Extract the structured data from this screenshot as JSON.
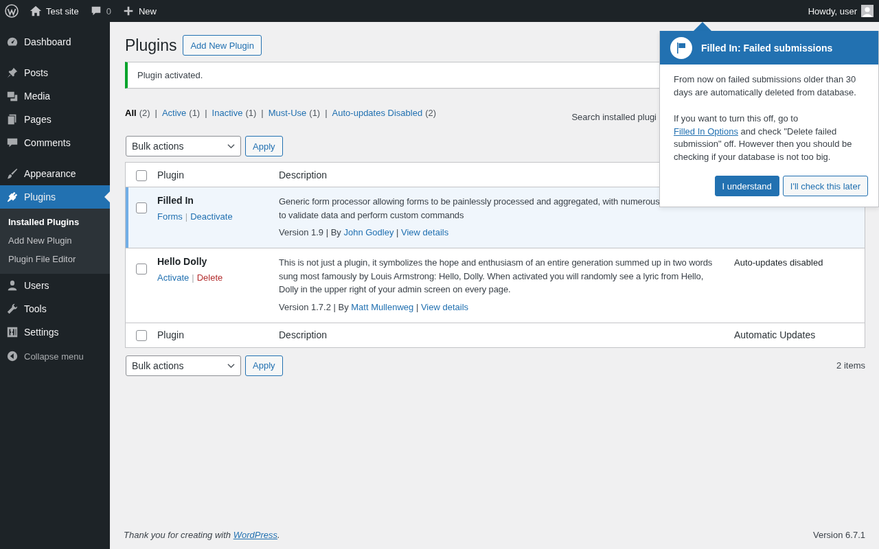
{
  "admin_bar": {
    "site": "Test site",
    "comments": "0",
    "new": "New",
    "greeting": "Howdy, user"
  },
  "menu": [
    {
      "items": [
        {
          "label": "Dashboard",
          "selected": false
        }
      ]
    },
    {
      "items": [
        {
          "label": "Posts",
          "selected": false
        },
        {
          "label": "Media",
          "selected": false
        },
        {
          "label": "Pages",
          "selected": false
        },
        {
          "label": "Comments",
          "selected": false
        }
      ]
    },
    {
      "items": [
        {
          "label": "Appearance",
          "selected": false
        },
        {
          "label": "Plugins",
          "selected": true,
          "submenu": [
            {
              "label": "Installed Plugins",
              "selected": true
            },
            {
              "label": "Add New Plugin",
              "selected": false
            },
            {
              "label": "Plugin File Editor",
              "selected": false
            }
          ]
        },
        {
          "label": "Users",
          "selected": false
        },
        {
          "label": "Tools",
          "selected": false
        },
        {
          "label": "Settings",
          "selected": false
        }
      ]
    }
  ],
  "collapse": "Collapse menu",
  "page": {
    "title": "Plugins",
    "add_button": "Add New Plugin",
    "notice": "Plugin activated.",
    "filters": [
      {
        "label": "All",
        "count": "(2)",
        "selected": true
      },
      {
        "separator": "|",
        "label": "Active",
        "count": "(1)",
        "selected": false
      },
      {
        "separator": "|",
        "label": "Inactive",
        "count": "(1)",
        "selected": false
      },
      {
        "separator": "|",
        "label": "Must-Use",
        "count": "(1)",
        "selected": false
      },
      {
        "separator": "|",
        "label": "Auto-updates Disabled",
        "count": "(2)",
        "selected": false
      }
    ],
    "search_label": "Search installed plugi",
    "bulk_actions": "Bulk actions",
    "apply": "Apply",
    "bulk_actions_bottom": "Bulk actions",
    "apply_bottom": "Apply",
    "items_count": "2 items"
  },
  "table": {
    "header": [
      "Plugin",
      "Description"
    ],
    "footer": [
      "Plugin",
      "Description",
      "Automatic Updates"
    ],
    "select_all_checked": false,
    "rows": [
      {
        "name": "Filled In",
        "active": true,
        "checked": false,
        "actions": [
          {
            "label": "Forms",
            "kind": "link"
          },
          {
            "separator": "|",
            "label": "Deactivate",
            "kind": "link"
          }
        ],
        "description_lines": [
          "Generic form processor allowing forms to be painlessly processed and aggregated, with numerous",
          "to validate data and perform custom commands"
        ],
        "version": "Version 1.9 | By ",
        "author": "John Godley",
        "separator": "|",
        "details": "View details"
      },
      {
        "name": "Hello Dolly",
        "active": false,
        "checked": false,
        "actions": [
          {
            "label": "Activate",
            "kind": "link"
          },
          {
            "separator": "|",
            "label": "Delete",
            "kind": "delete"
          }
        ],
        "description_lines": [
          "This is not just a plugin, it symbolizes the hope and enthusiasm of an entire generation summed up in two words sung most famously by Louis Armstrong: Hello, Dolly. When activated you will randomly see a lyric from Hello, Dolly in the upper right of your admin screen on every page."
        ],
        "version": "Version 1.7.2 | By ",
        "author": "Matt Mullenweg",
        "separator": "|",
        "details": "View details",
        "auto_updates": "Auto-updates disabled"
      }
    ]
  },
  "pointer": {
    "title": "Filled In: Failed submissions",
    "paragraph_1": "From now on failed submissions older than 30 days are automatically deleted from database.",
    "p2_before": "If you want to turn this off, go to ",
    "p2_link": "Filled In Options",
    "p2_after": " and check \"Delete failed submission\" off. However then you should be checking if your database is not too big.",
    "buttons": [
      {
        "label": "I understand",
        "kind": "primary"
      },
      {
        "label": "I'll check this later",
        "kind": "secondary"
      }
    ]
  },
  "footer": {
    "thanks": "Thank you for creating with ",
    "link": "WordPress",
    "after": ".",
    "version": "Version 6.7.1"
  }
}
